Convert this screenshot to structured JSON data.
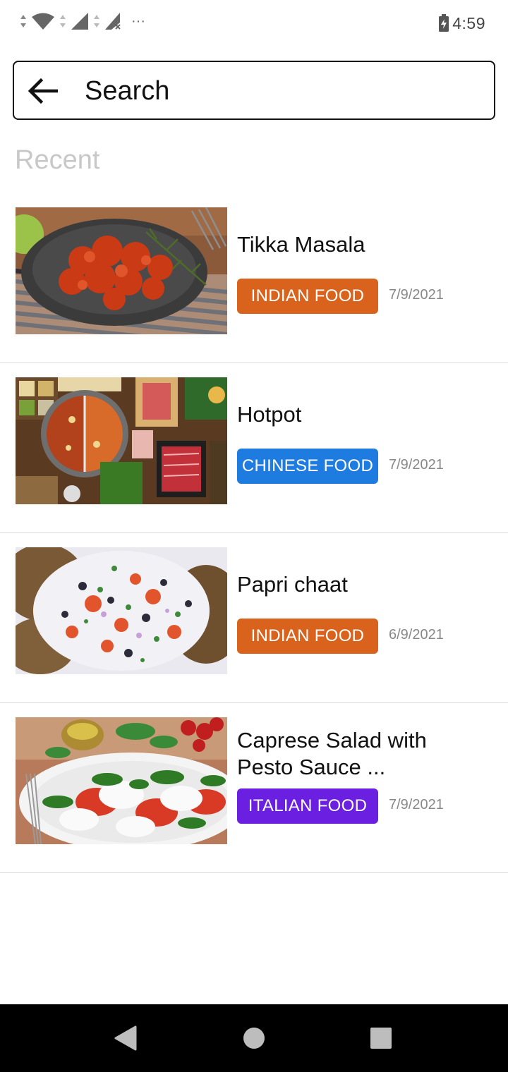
{
  "status_bar": {
    "time": "4:59",
    "more_indicator": "···",
    "icons": [
      "data-arrows-icon",
      "wifi-icon",
      "data-arrows-icon",
      "signal-icon",
      "data-arrows-icon",
      "signal-no-service-icon",
      "battery-charging-icon"
    ]
  },
  "search": {
    "placeholder": "Search",
    "value": "",
    "back_icon": "arrow-left-icon"
  },
  "section": {
    "title": "Recent"
  },
  "items": [
    {
      "title": "Tikka Masala",
      "tag": "INDIAN FOOD",
      "tag_color": "#D9631C",
      "date": "7/9/2021",
      "image": "tikka-masala-photo"
    },
    {
      "title": "Hotpot",
      "tag": "CHINESE FOOD",
      "tag_color": "#1E7BE0",
      "date": "7/9/2021",
      "image": "hotpot-photo"
    },
    {
      "title": "Papri chaat",
      "tag": "INDIAN FOOD",
      "tag_color": "#D9631C",
      "date": "6/9/2021",
      "image": "papri-chaat-photo"
    },
    {
      "title": "Caprese Salad with Pesto Sauce ...",
      "tag": "ITALIAN FOOD",
      "tag_color": "#6B1FE0",
      "date": "7/9/2021",
      "image": "caprese-salad-photo"
    }
  ],
  "nav_bar": {
    "buttons": [
      "back-triangle-icon",
      "home-circle-icon",
      "recents-square-icon"
    ]
  }
}
